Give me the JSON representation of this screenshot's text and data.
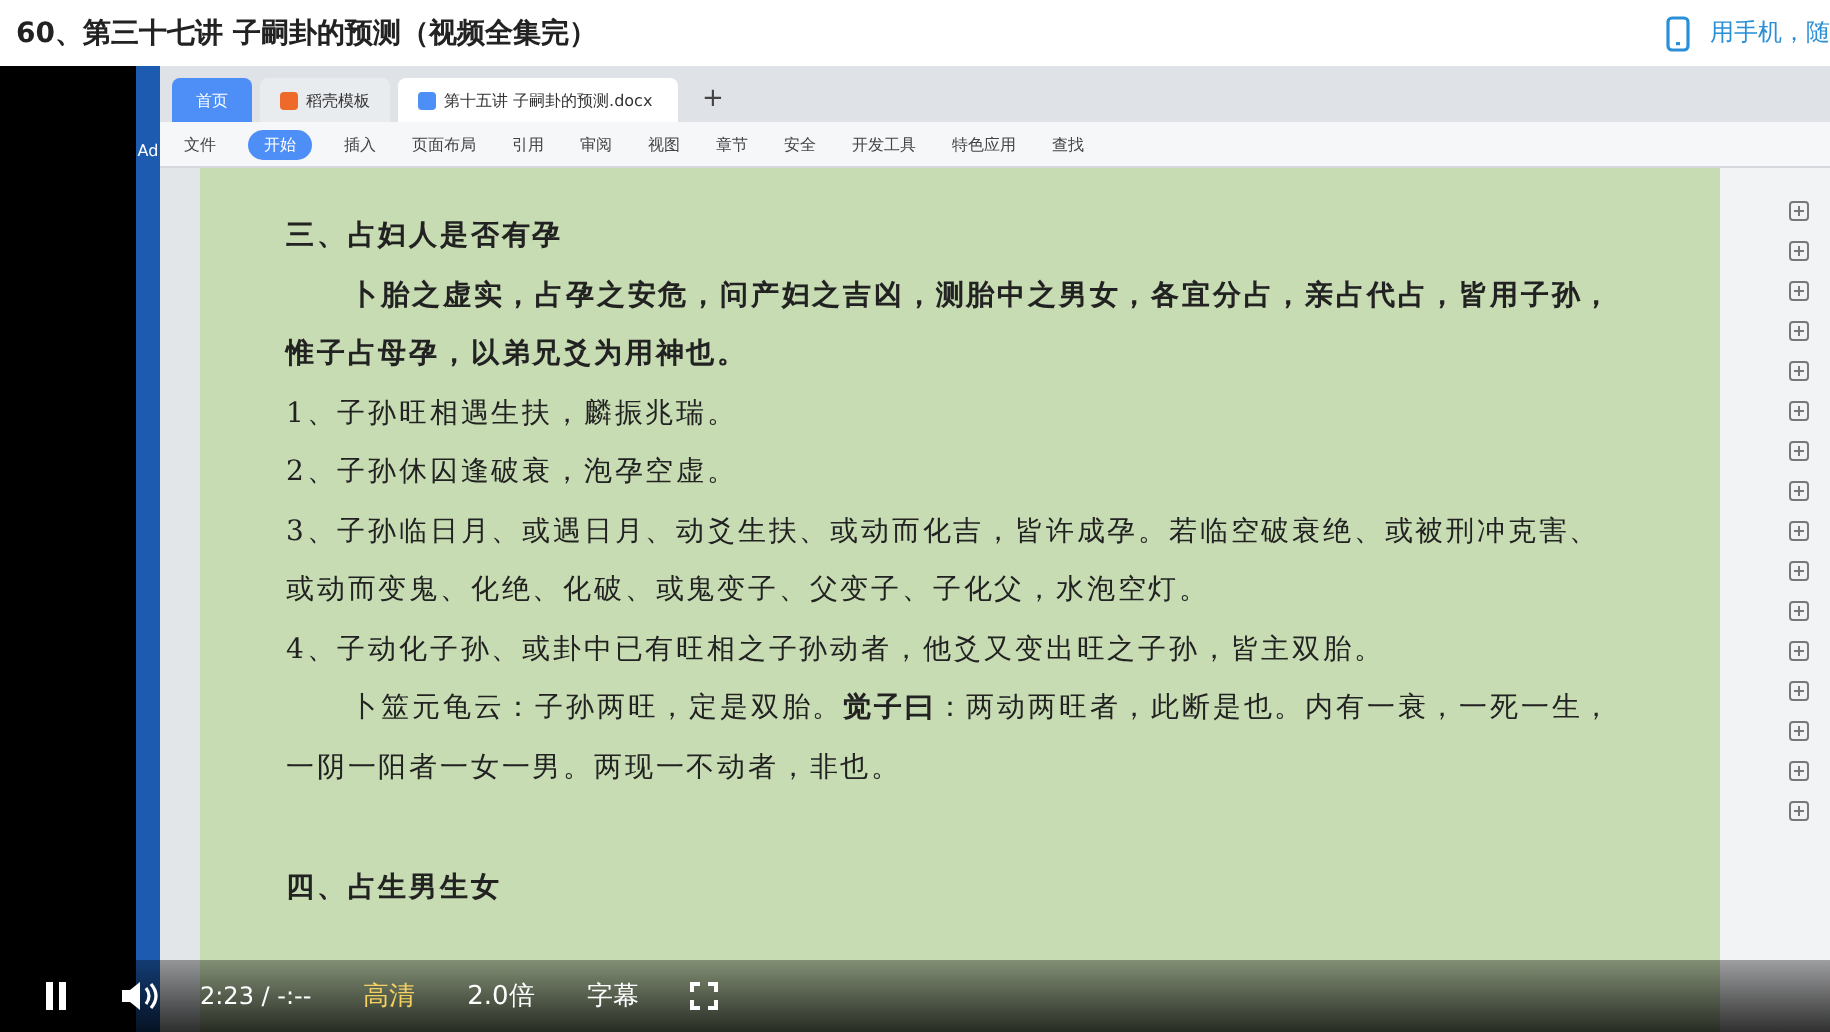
{
  "page_title": "60、第三十七讲 子嗣卦的预测（视频全集完）",
  "mobile_link": "用手机，随",
  "desktop": {
    "icon_label": "Ad"
  },
  "wps": {
    "tabs": [
      {
        "label": "首页",
        "kind": "home",
        "selected": false
      },
      {
        "label": "稻壳模板",
        "kind": "template",
        "selected": false
      },
      {
        "label": "第十五讲 子嗣卦的预测.docx",
        "kind": "doc",
        "selected": true
      }
    ],
    "add_tab": "+",
    "menu": [
      {
        "label": "文件",
        "selected": false
      },
      {
        "label": "开始",
        "selected": true
      },
      {
        "label": "插入",
        "selected": false
      },
      {
        "label": "页面布局",
        "selected": false
      },
      {
        "label": "引用",
        "selected": false
      },
      {
        "label": "审阅",
        "selected": false
      },
      {
        "label": "视图",
        "selected": false
      },
      {
        "label": "章节",
        "selected": false
      },
      {
        "label": "安全",
        "selected": false
      },
      {
        "label": "开发工具",
        "selected": false
      },
      {
        "label": "特色应用",
        "selected": false
      },
      {
        "label": "查找",
        "selected": false
      }
    ]
  },
  "document": {
    "paragraphs": [
      {
        "kind": "heading",
        "text": "三、占妇人是否有孕"
      },
      {
        "kind": "lead",
        "text": "卜胎之虚实，占孕之安危，问产妇之吉凶，测胎中之男女，各宜分占，亲占代占，皆用子孙，惟子占母孕，以弟兄爻为用神也。"
      },
      {
        "kind": "item",
        "text": "1、子孙旺相遇生扶，麟振兆瑞。"
      },
      {
        "kind": "item",
        "text": "2、子孙休囚逢破衰，泡孕空虚。"
      },
      {
        "kind": "item",
        "text": "3、子孙临日月、或遇日月、动爻生扶、或动而化吉，皆许成孕。若临空破衰绝、或被刑冲克害、或动而变鬼、化绝、化破、或鬼变子、父变子、子化父，水泡空灯。"
      },
      {
        "kind": "item",
        "text": "4、子动化子孙、或卦中已有旺相之子孙动者，他爻又变出旺之子孙，皆主双胎。"
      },
      {
        "kind": "quote",
        "text": "卜筮元龟云：子孙两旺，定是双胎。**觉子曰**：两动两旺者，此断是也。内有一衰，一死一生，一阴一阳者一女一男。两现一不动者，非也。"
      },
      {
        "kind": "heading",
        "text": "四、占生男生女"
      }
    ]
  },
  "player": {
    "playing": true,
    "time": "2:23 / -:--",
    "options": [
      {
        "label": "高清",
        "selected": true
      },
      {
        "label": "2.0倍",
        "selected": false
      },
      {
        "label": "字幕",
        "selected": false
      }
    ]
  }
}
